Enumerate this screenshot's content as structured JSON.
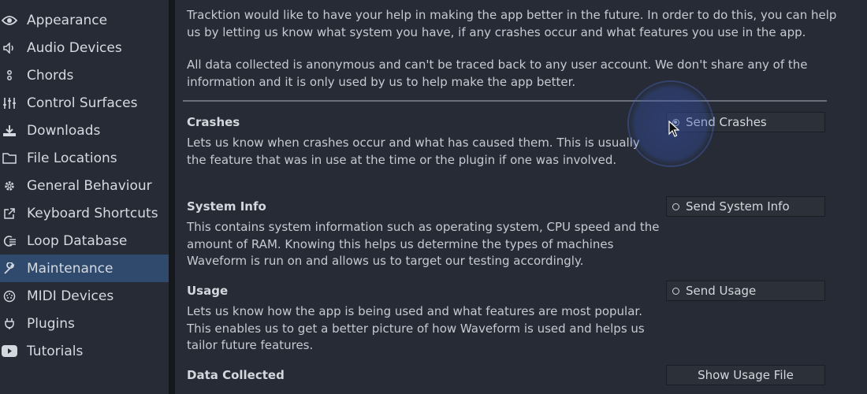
{
  "sidebar": {
    "items": [
      {
        "label": "Appearance",
        "icon": "eye-icon"
      },
      {
        "label": "Audio Devices",
        "icon": "speaker-icon"
      },
      {
        "label": "Chords",
        "icon": "chords-icon"
      },
      {
        "label": "Control Surfaces",
        "icon": "sliders-icon"
      },
      {
        "label": "Downloads",
        "icon": "download-icon"
      },
      {
        "label": "File Locations",
        "icon": "folder-icon"
      },
      {
        "label": "General Behaviour",
        "icon": "gear-icon"
      },
      {
        "label": "Keyboard Shortcuts",
        "icon": "external-link-icon"
      },
      {
        "label": "Loop Database",
        "icon": "loop-database-icon"
      },
      {
        "label": "Maintenance",
        "icon": "wrench-icon",
        "active": true
      },
      {
        "label": "MIDI Devices",
        "icon": "midi-icon"
      },
      {
        "label": "Plugins",
        "icon": "plug-icon"
      },
      {
        "label": "Tutorials",
        "icon": "youtube-icon"
      }
    ]
  },
  "main": {
    "intro1": "Tracktion would like to have your help in making the app better in the future. In order to do this, you can help us by letting us know what system you have, if any crashes occur and what features you use in the app.",
    "intro2": "All data collected is anonymous and can't be traced back to any user account. We don't share any of the information and it is only used by us to help make the app better.",
    "sections": {
      "crashes": {
        "title": "Crashes",
        "desc": "Lets us know when crashes occur and what has caused them. This is usually the feature that was in use at the time or the plugin if one was involved.",
        "button": "Send Crashes",
        "checked": true
      },
      "system_info": {
        "title": "System Info",
        "desc": "This contains system information such as operating system, CPU speed and the amount of RAM. Knowing this helps us determine the types of machines Waveform is run on and allows us to target our testing accordingly.",
        "button": "Send System Info",
        "checked": false
      },
      "usage": {
        "title": "Usage",
        "desc": "Lets us know how the app is being used and what features are most popular. This enables us to get a better picture of how Waveform is used and helps us tailor future features.",
        "button": "Send Usage",
        "checked": false
      },
      "data_collected": {
        "title": "Data Collected",
        "button": "Show Usage File"
      }
    }
  },
  "colors": {
    "background": "#262b35",
    "active_item": "#2f4a6d",
    "button_bg": "#2b3039",
    "highlight": "#3755b4"
  }
}
